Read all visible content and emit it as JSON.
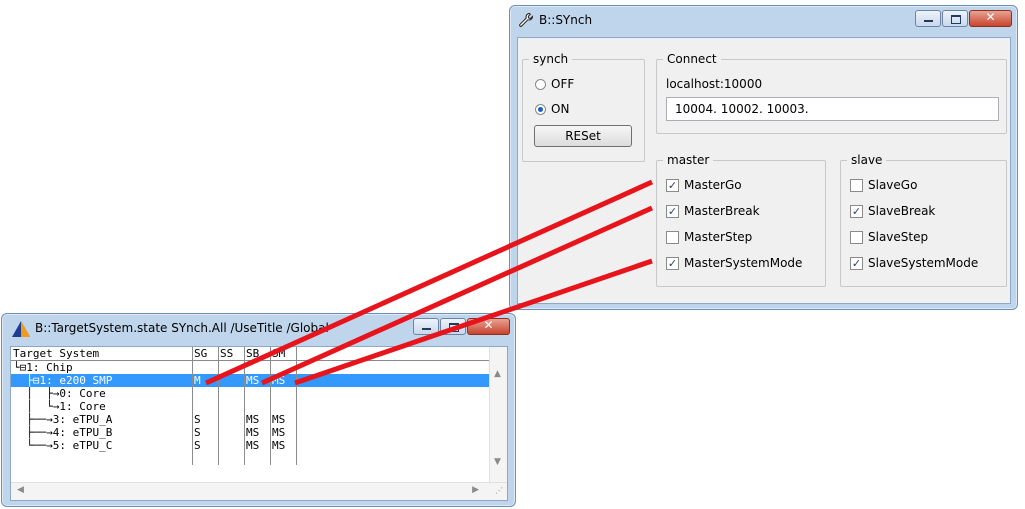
{
  "synch_window": {
    "title": "B::SYnch",
    "icon": "wrench-icon",
    "synch_group": {
      "legend": "synch",
      "off_label": "OFF",
      "on_label": "ON",
      "selected": "ON",
      "reset_label": "RESet"
    },
    "connect_group": {
      "legend": "Connect",
      "host": "localhost:10000",
      "ports_value": "10004. 10002. 10003."
    },
    "master_group": {
      "legend": "master",
      "items": [
        {
          "label": "MasterGo",
          "checked": true
        },
        {
          "label": "MasterBreak",
          "checked": true
        },
        {
          "label": "MasterStep",
          "checked": false
        },
        {
          "label": "MasterSystemMode",
          "checked": true
        }
      ]
    },
    "slave_group": {
      "legend": "slave",
      "items": [
        {
          "label": "SlaveGo",
          "checked": false
        },
        {
          "label": "SlaveBreak",
          "checked": true
        },
        {
          "label": "SlaveStep",
          "checked": false
        },
        {
          "label": "SlaveSystemMode",
          "checked": true
        }
      ]
    }
  },
  "target_window": {
    "title": "B::TargetSystem.state SYnch.All /UseTitle /Global",
    "icon": "trace32-triangle-icon",
    "columns": [
      "Target System",
      "SG",
      "SS",
      "SB",
      "SM"
    ],
    "rows": [
      {
        "tree": "└⊟1: Chip",
        "sg": "",
        "ss": "",
        "sb": "",
        "sm": "",
        "selected": false
      },
      {
        "tree": "  ├⊟1: e200 SMP",
        "sg": "M",
        "ss": "",
        "sb": "MS",
        "sm": "MS",
        "selected": true
      },
      {
        "tree": "  │  ├→0: Core",
        "sg": "",
        "ss": "",
        "sb": "",
        "sm": "",
        "selected": false
      },
      {
        "tree": "  │  └→1: Core",
        "sg": "",
        "ss": "",
        "sb": "",
        "sm": "",
        "selected": false
      },
      {
        "tree": "  ├──→3: eTPU_A",
        "sg": "S",
        "ss": "",
        "sb": "MS",
        "sm": "MS",
        "selected": false
      },
      {
        "tree": "  ├──→4: eTPU_B",
        "sg": "S",
        "ss": "",
        "sb": "MS",
        "sm": "MS",
        "selected": false
      },
      {
        "tree": "  └──→5: eTPU_C",
        "sg": "S",
        "ss": "",
        "sb": "MS",
        "sm": "MS",
        "selected": false
      }
    ]
  },
  "colors": {
    "connector": "#e8141c",
    "selection": "#3399ff",
    "window_frame": "#bfd5ec"
  }
}
